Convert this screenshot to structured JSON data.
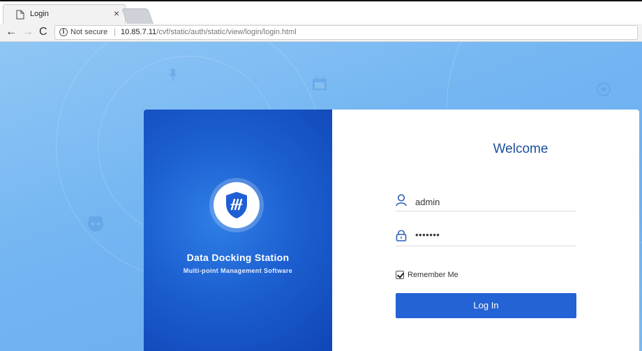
{
  "browser": {
    "tab_title": "Login",
    "tab_close": "×",
    "nav": {
      "back": "←",
      "forward": "→",
      "reload": "C"
    },
    "security_label": "Not secure",
    "separator": "|",
    "url_host": "10.85.7.11",
    "url_path": "/cvf/static/auth/static/view/login/login.html"
  },
  "brand": {
    "title": "Data Docking Station",
    "subtitle": "Multi-point Management Software",
    "accent_color": "#1c5fd0"
  },
  "login": {
    "heading": "Welcome",
    "username_value": "admin",
    "password_value": "•••••••",
    "remember_label": "Remember Me",
    "remember_checked": true,
    "submit_label": "Log In",
    "button_color": "#2463d5"
  },
  "icons": [
    "doc-icon",
    "info-icon",
    "user-icon",
    "lock-icon",
    "shield-logo-icon",
    "checkbox-icon"
  ]
}
